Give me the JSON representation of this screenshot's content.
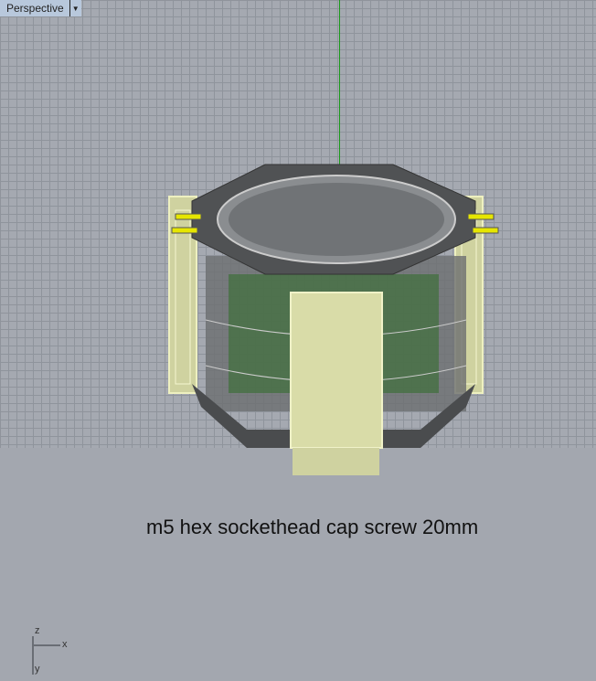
{
  "viewport": {
    "name": "Perspective",
    "menu_icon": "dropdown-arrow-icon"
  },
  "caption": "m5 hex sockethead cap screw 20mm",
  "axis_widget": {
    "z": "z",
    "x": "x",
    "y": "y"
  },
  "colors": {
    "y_axis": "#1a9a1a",
    "highlight": "#e6e600",
    "wireframe": "#e3e5b0"
  }
}
